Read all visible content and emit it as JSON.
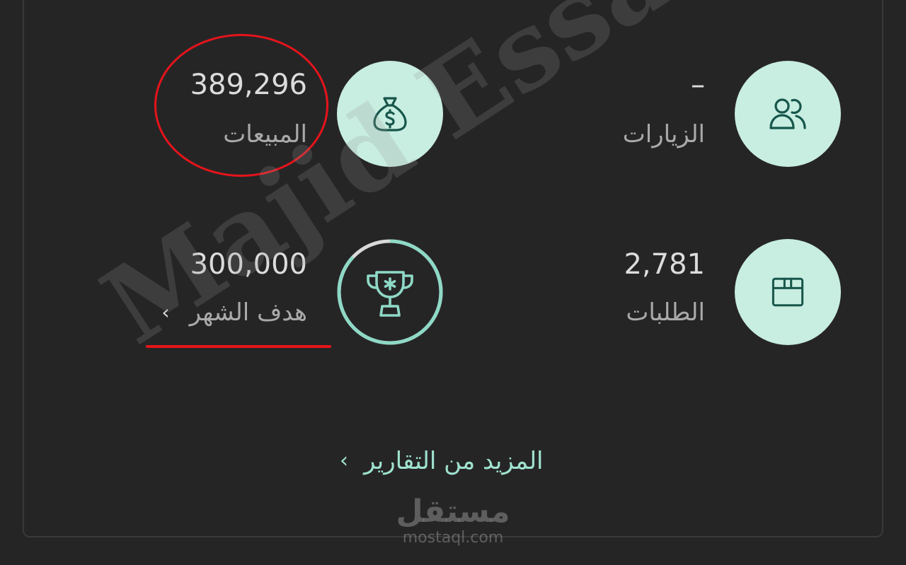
{
  "stats": {
    "visits": {
      "value": "–",
      "label": "الزيارات",
      "icon": "users-icon"
    },
    "sales": {
      "value": "389,296",
      "label": "المبيعات",
      "icon": "money-bag-icon"
    },
    "orders": {
      "value": "2,781",
      "label": "الطلبات",
      "icon": "box-icon"
    },
    "goal": {
      "value": "300,000",
      "label": "هدف الشهر",
      "icon": "trophy-icon",
      "chevron": "‹",
      "progress": 0.87
    }
  },
  "more_reports": {
    "label": "المزيد من التقارير",
    "chevron": "‹"
  },
  "watermark": {
    "text": "Majid Essa"
  },
  "brand": {
    "arabic": "مستقل",
    "url": "mostaql.com"
  },
  "colors": {
    "background": "#262526",
    "icon_circle": "#c8ede1",
    "icon_stroke": "#17564a",
    "accent": "#9fe3cf",
    "annotation": "#e5141b"
  }
}
